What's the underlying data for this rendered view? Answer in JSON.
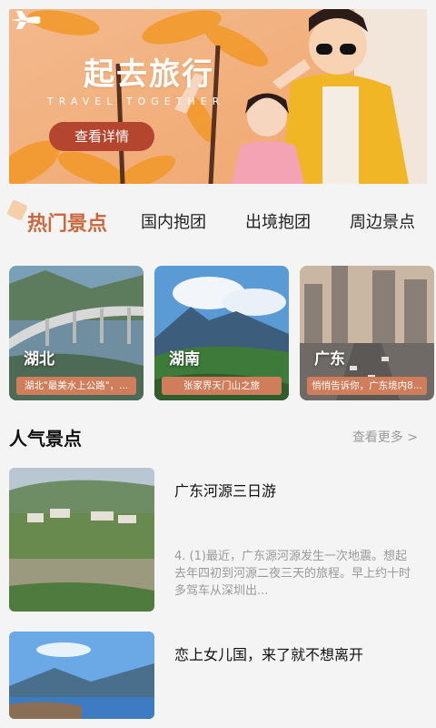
{
  "banner": {
    "title": "起去旅行",
    "subtitle": "TRAVEL TOGETHER",
    "button_label": "查看详情"
  },
  "tabs": [
    {
      "label": "热门景点",
      "active": true
    },
    {
      "label": "国内抱团",
      "active": false
    },
    {
      "label": "出境抱团",
      "active": false
    },
    {
      "label": "周边景点",
      "active": false
    }
  ],
  "destinations": [
    {
      "name": "湖北",
      "caption": "湖北\"最美水上公路\"，..."
    },
    {
      "name": "湖南",
      "caption": "张家界天门山之旅"
    },
    {
      "name": "广东",
      "caption": "悄悄告诉你，广东境内8..."
    }
  ],
  "popular": {
    "title": "人气景点",
    "more_label": "查看更多 >"
  },
  "articles": [
    {
      "title": "广东河源三日游",
      "desc": "4. (1)最近，广东源河源发生一次地震。想起去年四初到河源二夜三天的旅程。早上约十时多驾车从深圳出..."
    },
    {
      "title": "恋上女儿国，来了就不想离开",
      "desc": ""
    }
  ],
  "colors": {
    "accent": "#c9683f",
    "caption_bg": "#cf7d5a",
    "banner_button": "#b4452f"
  }
}
